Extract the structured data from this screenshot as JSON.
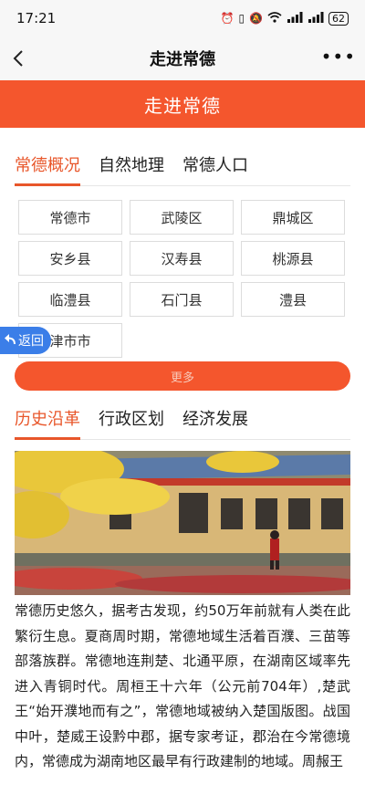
{
  "status": {
    "time": "17:21",
    "battery": "62"
  },
  "nav": {
    "title": "走进常德"
  },
  "banner": {
    "title": "走进常德"
  },
  "tabs_primary": [
    {
      "label": "常德概况",
      "active": true
    },
    {
      "label": "自然地理",
      "active": false
    },
    {
      "label": "常德人口",
      "active": false
    }
  ],
  "districts": [
    "常德市",
    "武陵区",
    "鼎城区",
    "安乡县",
    "汉寿县",
    "桃源县",
    "临澧县",
    "石门县",
    "澧县",
    "津市市"
  ],
  "float_back": {
    "label": "返回"
  },
  "more_button": {
    "label": "更多"
  },
  "tabs_secondary": [
    {
      "label": "历史沿革",
      "active": true
    },
    {
      "label": "行政区划",
      "active": false
    },
    {
      "label": "经济发展",
      "active": false
    }
  ],
  "article": {
    "text": "常德历史悠久，据考古发现，约50万年前就有人类在此繁衍生息。夏商周时期，常德地域生活着百濮、三苗等部落族群。常德地连荆楚、北通平原，在湖南区域率先进入青铜时代。周桓王十六年（公元前704年）,楚武王“始开濮地而有之”，常德地域被纳入楚国版图。战国中叶，楚威王设黔中郡，据专家考证，郡治在今常德境内，常德成为湖南地区最早有行政建制的地域。周赧王"
  },
  "colors": {
    "accent": "#f4562d",
    "tab_active": "#e8562a",
    "float_back": "#3b7ee8"
  }
}
